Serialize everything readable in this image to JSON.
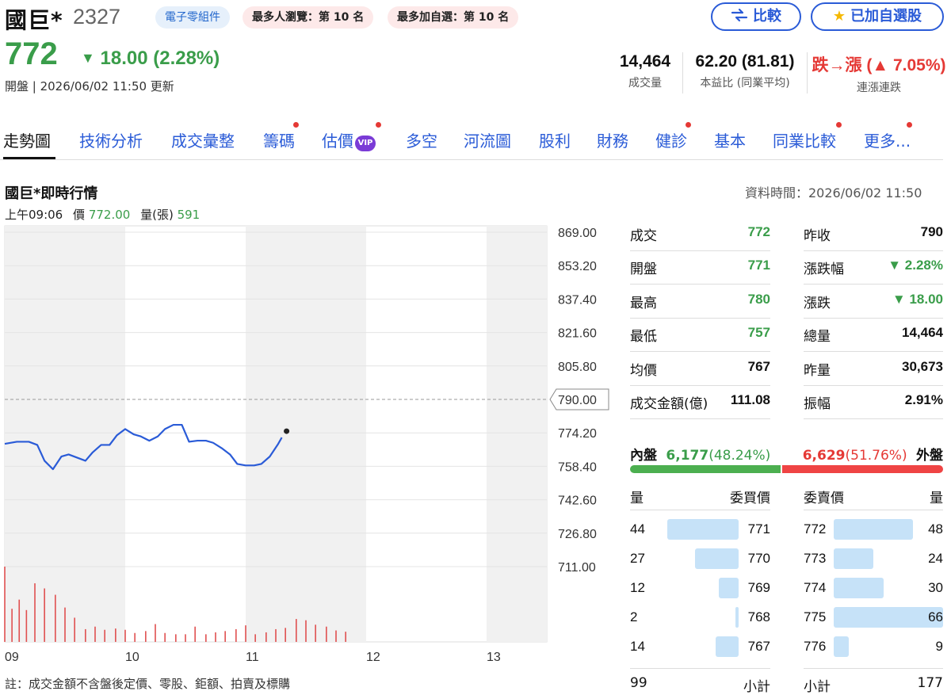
{
  "header": {
    "name": "國巨*",
    "code": "2327",
    "tags": [
      {
        "label": "電子零組件",
        "style": "blue"
      },
      {
        "label": "最多人瀏覽：第 10 名",
        "style": "pink"
      },
      {
        "label": "最多加自選：第 10 名",
        "style": "pink"
      }
    ],
    "compare_label": "比較",
    "watchlist_label": "已加自選股"
  },
  "price": {
    "last": "772",
    "change": "18.00 (2.28%)",
    "meta": "開盤 | 2026/06/02 11:50 更新"
  },
  "stats": [
    {
      "value": "14,464",
      "label": "成交量"
    },
    {
      "value": "62.20 (81.81)",
      "label": "本益比 (同業平均)"
    },
    {
      "value": "跌→漲 (▲ 7.05%)",
      "label": "連漲連跌"
    }
  ],
  "tabs": [
    {
      "label": "走勢圖",
      "active": true,
      "dot": false,
      "vip": false
    },
    {
      "label": "技術分析",
      "active": false,
      "dot": false,
      "vip": false
    },
    {
      "label": "成交彙整",
      "active": false,
      "dot": false,
      "vip": false
    },
    {
      "label": "籌碼",
      "active": false,
      "dot": true,
      "vip": false
    },
    {
      "label": "估價",
      "active": false,
      "dot": true,
      "vip": true
    },
    {
      "label": "多空",
      "active": false,
      "dot": false,
      "vip": false
    },
    {
      "label": "河流圖",
      "active": false,
      "dot": false,
      "vip": false
    },
    {
      "label": "股利",
      "active": false,
      "dot": false,
      "vip": false
    },
    {
      "label": "財務",
      "active": false,
      "dot": false,
      "vip": false
    },
    {
      "label": "健診",
      "active": false,
      "dot": true,
      "vip": false
    },
    {
      "label": "基本",
      "active": false,
      "dot": false,
      "vip": false
    },
    {
      "label": "同業比較",
      "active": false,
      "dot": true,
      "vip": false
    },
    {
      "label": "更多...",
      "active": false,
      "dot": true,
      "vip": false
    }
  ],
  "vip_badge": "VIP",
  "section": {
    "title": "國巨*即時行情",
    "time": "資料時間：2026/06/02 11:50"
  },
  "hover": {
    "time": "上午09:06",
    "price_label": "價",
    "price": "772.00",
    "vol_label": "量(張)",
    "vol": "591"
  },
  "chart_data": {
    "type": "line",
    "y_ticks": [
      "869.00",
      "853.20",
      "837.40",
      "821.60",
      "805.80",
      "790.00",
      "774.20",
      "758.40",
      "742.60",
      "726.80",
      "711.00"
    ],
    "ylim": [
      711,
      869
    ],
    "reference_price": 790,
    "reference_label": "790.00",
    "x_ticks": [
      "09",
      "10",
      "11",
      "12",
      "13"
    ],
    "price_series": {
      "x_hours": [
        9.0,
        0.0
      ],
      "points": [
        [
          9.0,
          769.0
        ],
        [
          9.1,
          770.0
        ],
        [
          9.2,
          770.0
        ],
        [
          9.27,
          768.5
        ],
        [
          9.33,
          761.0
        ],
        [
          9.4,
          757.0
        ],
        [
          9.47,
          763.0
        ],
        [
          9.53,
          764.0
        ],
        [
          9.6,
          762.5
        ],
        [
          9.67,
          761.0
        ],
        [
          9.73,
          765.0
        ],
        [
          9.8,
          768.5
        ],
        [
          9.87,
          768.5
        ],
        [
          9.93,
          773.0
        ],
        [
          10.0,
          776.0
        ],
        [
          10.07,
          773.5
        ],
        [
          10.13,
          772.5
        ],
        [
          10.2,
          770.5
        ],
        [
          10.27,
          772.5
        ],
        [
          10.33,
          776.0
        ],
        [
          10.4,
          778.0
        ],
        [
          10.47,
          778.0
        ],
        [
          10.53,
          770.0
        ],
        [
          10.6,
          770.5
        ],
        [
          10.67,
          770.5
        ],
        [
          10.73,
          769.5
        ],
        [
          10.8,
          767.0
        ],
        [
          10.87,
          764.0
        ],
        [
          10.93,
          759.5
        ],
        [
          11.0,
          758.8
        ],
        [
          11.07,
          758.8
        ],
        [
          11.13,
          759.5
        ],
        [
          11.2,
          763.0
        ],
        [
          11.27,
          769.0
        ],
        [
          11.3,
          772.0
        ]
      ]
    },
    "volume_series": [
      [
        9.0,
        591
      ],
      [
        9.06,
        260
      ],
      [
        9.12,
        332
      ],
      [
        9.18,
        250
      ],
      [
        9.25,
        460
      ],
      [
        9.33,
        420
      ],
      [
        9.42,
        370
      ],
      [
        9.5,
        270
      ],
      [
        9.58,
        190
      ],
      [
        9.67,
        100
      ],
      [
        9.75,
        120
      ],
      [
        9.83,
        95
      ],
      [
        9.92,
        105
      ],
      [
        10.0,
        95
      ],
      [
        10.08,
        70
      ],
      [
        10.17,
        85
      ],
      [
        10.25,
        140
      ],
      [
        10.33,
        70
      ],
      [
        10.42,
        60
      ],
      [
        10.5,
        60
      ],
      [
        10.58,
        120
      ],
      [
        10.67,
        60
      ],
      [
        10.75,
        75
      ],
      [
        10.83,
        85
      ],
      [
        10.92,
        100
      ],
      [
        11.0,
        130
      ],
      [
        11.08,
        60
      ],
      [
        11.17,
        75
      ],
      [
        11.25,
        100
      ],
      [
        11.33,
        110
      ],
      [
        11.42,
        180
      ],
      [
        11.5,
        170
      ],
      [
        11.58,
        135
      ],
      [
        11.67,
        120
      ],
      [
        11.75,
        90
      ],
      [
        11.83,
        80
      ]
    ]
  },
  "quote": {
    "left": [
      {
        "label": "成交",
        "value": "772",
        "color": "green"
      },
      {
        "label": "開盤",
        "value": "771",
        "color": "green"
      },
      {
        "label": "最高",
        "value": "780",
        "color": "green"
      },
      {
        "label": "最低",
        "value": "757",
        "color": "green"
      },
      {
        "label": "均價",
        "value": "767",
        "color": "black"
      },
      {
        "label": "成交金額(億)",
        "value": "111.08",
        "color": "black"
      }
    ],
    "right": [
      {
        "label": "昨收",
        "value": "790",
        "color": "black"
      },
      {
        "label": "漲跌幅",
        "value": "▼ 2.28%",
        "color": "green"
      },
      {
        "label": "漲跌",
        "value": "▼ 18.00",
        "color": "green"
      },
      {
        "label": "總量",
        "value": "14,464",
        "color": "black"
      },
      {
        "label": "昨量",
        "value": "30,673",
        "color": "black"
      },
      {
        "label": "振幅",
        "value": "2.91%",
        "color": "black"
      }
    ]
  },
  "inner_outer": {
    "inner_label": "內盤",
    "inner_value": "6,177",
    "inner_pct": "(48.24%)",
    "inner_ratio": 0.4824,
    "outer_value": "6,629",
    "outer_pct": "(51.76%)",
    "outer_label": "外盤"
  },
  "orderbook": {
    "head_bid_qty": "量",
    "head_bid_price": "委買價",
    "head_ask_price": "委賣價",
    "head_ask_qty": "量",
    "bids": [
      {
        "qty": "44",
        "price": "771"
      },
      {
        "qty": "27",
        "price": "770"
      },
      {
        "qty": "12",
        "price": "769"
      },
      {
        "qty": "2",
        "price": "768"
      },
      {
        "qty": "14",
        "price": "767"
      }
    ],
    "asks": [
      {
        "price": "772",
        "qty": "48"
      },
      {
        "price": "773",
        "qty": "24"
      },
      {
        "price": "774",
        "qty": "30"
      },
      {
        "price": "775",
        "qty": "66"
      },
      {
        "price": "776",
        "qty": "9"
      }
    ],
    "bid_total": "99",
    "bid_total_label": "小計",
    "ask_total_label": "小計",
    "ask_total": "177"
  },
  "note": "註：成交金額不含盤後定價、零股、鉅額、拍賣及標購",
  "colors": {
    "up": "#e53935",
    "down": "#3a9d4a",
    "accent": "#2a5bd7",
    "line": "#2a5bd7"
  }
}
